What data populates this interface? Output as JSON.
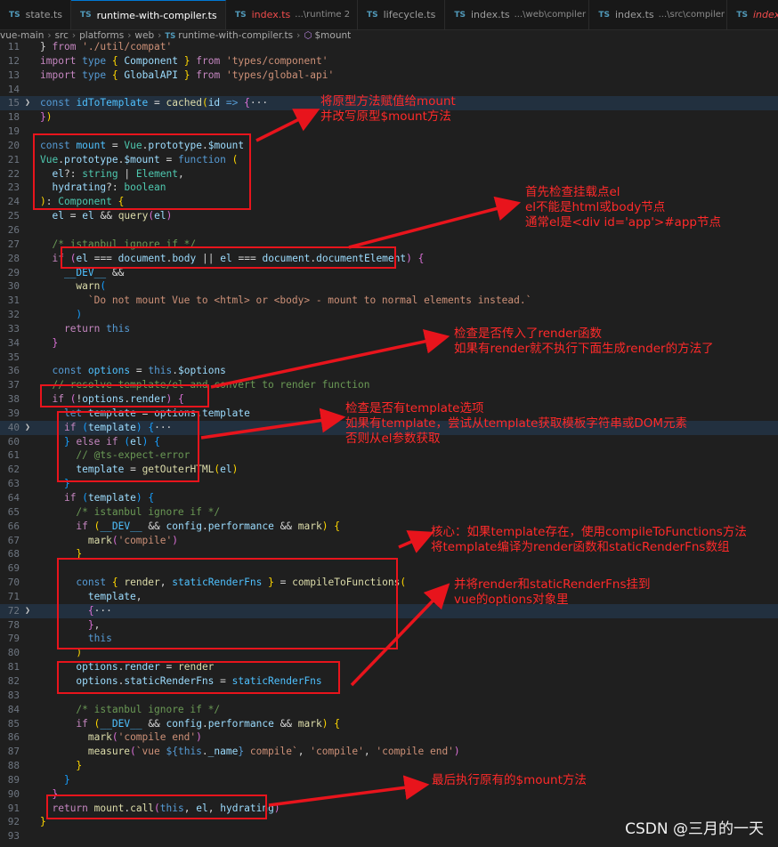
{
  "tabs": [
    {
      "label": "state.ts",
      "hint": "",
      "icon": "TS",
      "active": false,
      "modified": false
    },
    {
      "label": "runtime-with-compiler.ts",
      "hint": "",
      "icon": "TS",
      "active": true,
      "modified": false
    },
    {
      "label": "index.ts",
      "hint": "...\\runtime 2",
      "icon": "TS",
      "active": false,
      "modified": true
    },
    {
      "label": "lifecycle.ts",
      "hint": "",
      "icon": "TS",
      "active": false,
      "modified": false
    },
    {
      "label": "index.ts",
      "hint": "...\\web\\compiler",
      "icon": "TS",
      "active": false,
      "modified": false
    },
    {
      "label": "index.ts",
      "hint": "...\\src\\compiler",
      "icon": "TS",
      "active": false,
      "modified": false
    },
    {
      "label": "index",
      "hint": "",
      "icon": "TS",
      "active": false,
      "modified": true
    }
  ],
  "breadcrumbs": [
    "vue-main",
    "src",
    "platforms",
    "web",
    "runtime-with-compiler.ts",
    "$mount"
  ],
  "annotations": {
    "a1": [
      "将原型方法赋值给mount",
      "并改写原型$mount方法"
    ],
    "a2": [
      "首先检查挂载点el",
      "el不能是html或body节点",
      "通常el是<div id='app'>#app节点"
    ],
    "a3": [
      "检查是否传入了render函数",
      "如果有render就不执行下面生成render的方法了"
    ],
    "a4": [
      "检查是否有template选项",
      "如果有template，尝试从template获取模板字符串或DOM元素",
      "否则从el参数获取"
    ],
    "a5": [
      "核心：如果template存在，使用compileToFunctions方法",
      "将template编译为render函数和staticRenderFns数组"
    ],
    "a6": [
      "并将render和staticRenderFns挂到",
      "vue的options对象里"
    ],
    "a7": [
      "最后执行原有的$mount方法"
    ]
  },
  "watermark": "CSDN @三月的一天",
  "colors": {
    "annotation": "#ff2a2a",
    "box": "#e8141c",
    "accent": "#0078d4"
  }
}
